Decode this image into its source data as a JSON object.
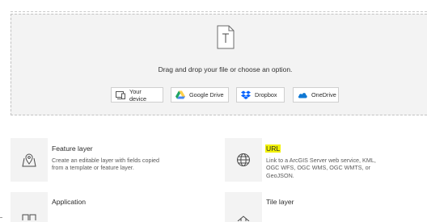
{
  "dropzone": {
    "prompt": "Drag and drop your file or choose an option.",
    "options": [
      {
        "label": "Your device",
        "icon": "device-icon"
      },
      {
        "label": "Google Drive",
        "icon": "google-drive-icon"
      },
      {
        "label": "Dropbox",
        "icon": "dropbox-icon"
      },
      {
        "label": "OneDrive",
        "icon": "onedrive-icon"
      }
    ]
  },
  "items": {
    "feature_layer": {
      "title": "Feature layer",
      "description_lines": [
        "Create an editable layer with fields copied",
        "from a template or feature layer."
      ],
      "icon": "map-pin-icon"
    },
    "url": {
      "title": "URL",
      "description_lines": [
        "Link to a ArcGIS Server web service, KML,",
        "OGC WFS, OGC WMS, OGC WMTS, or",
        "GeoJSON."
      ],
      "icon": "globe-icon"
    },
    "application": {
      "title": "Application",
      "icon": "application-icon"
    },
    "tile_layer": {
      "title": "Tile layer",
      "icon": "tile-layer-icon"
    }
  },
  "colors": {
    "highlight": "#f2f200",
    "panel": "#f3f3f3",
    "google_green": "#1fa463",
    "google_yellow": "#ffd04b",
    "google_blue": "#4688f4",
    "dropbox_blue": "#0061fe",
    "onedrive_blue": "#0f78d4"
  }
}
